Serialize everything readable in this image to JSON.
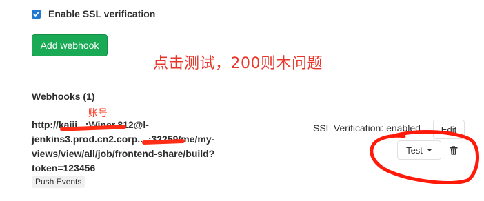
{
  "ssl_verification": {
    "label": "Enable SSL verification",
    "checked": true
  },
  "add_webhook_label": "Add webhook",
  "annotation_test_note": "点击测试，200则木问题",
  "annotation_account": "账号",
  "webhooks": {
    "title": "Webhooks (1)",
    "items": [
      {
        "url": "http://kaiji...:Winer.812@l-\njenkins3.prod.cn2.corp....:32259/me/my-\nviews/view/all/job/frontend-share/build?\ntoken=123456",
        "events": [
          "Push Events"
        ],
        "ssl_status": "SSL Verification: enabled",
        "edit_label": "Edit",
        "test_label": "Test"
      }
    ]
  },
  "colors": {
    "accent": "#1f78d1",
    "add_button": "#1aaa55",
    "annotation_red": "#ff2d16"
  },
  "icons": {
    "checkbox": "check-icon",
    "dropdown": "caret-down-icon",
    "delete": "trash-icon"
  }
}
